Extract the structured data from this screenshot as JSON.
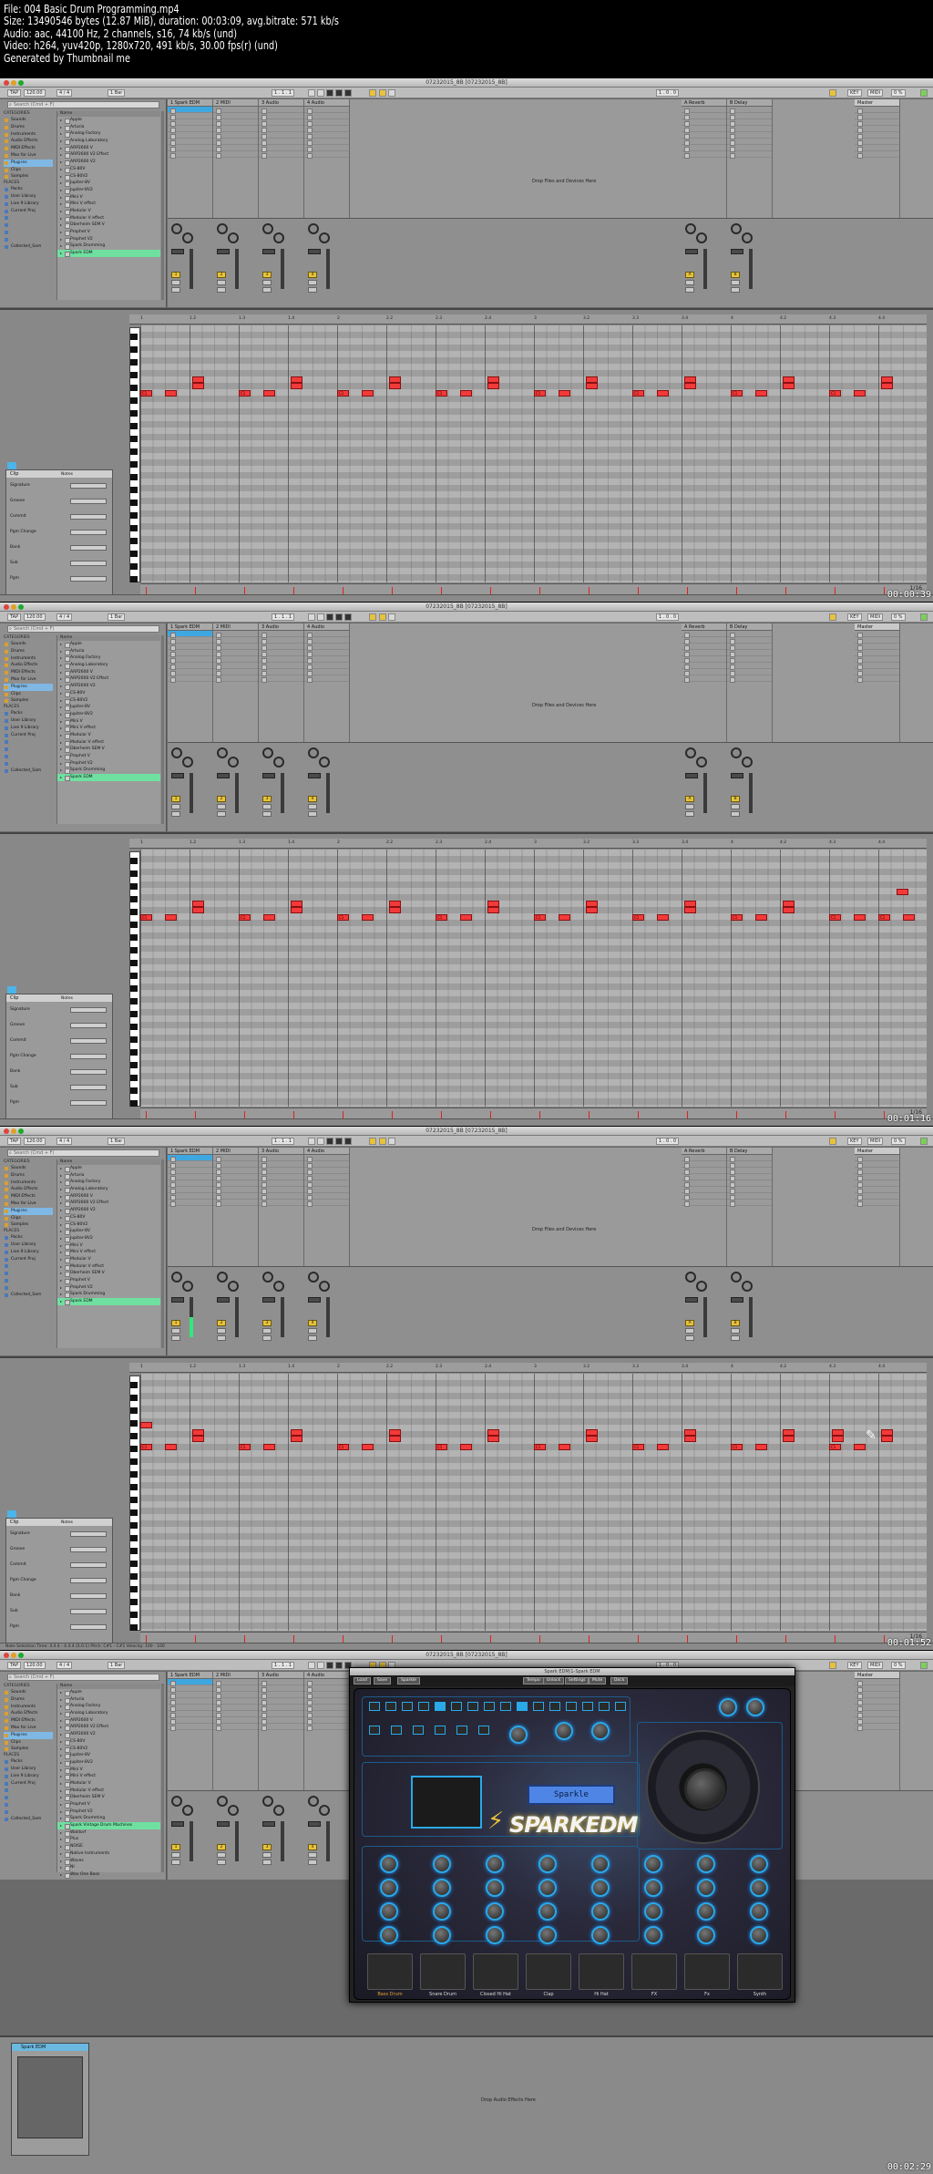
{
  "thumbnail_info": {
    "lines": [
      "File: 004 Basic Drum Programming.mp4",
      "Size: 13490546 bytes (12.87 MiB), duration: 00:03:09, avg.bitrate: 571 kb/s",
      "Audio: aac, 44100 Hz, 2 channels, s16, 74 kb/s (und)",
      "Video: h264, yuv420p, 1280x720, 491 kb/s, 30.00 fps(r) (und)",
      "Generated by Thumbnail me"
    ]
  },
  "window": {
    "title": "07232015_8B  [07232015_8B]"
  },
  "controlbar": {
    "tap": "TAP",
    "tempo": "120.00",
    "sig": "4 / 4",
    "quant": "1 Bar",
    "pos1": "1 . 1 . 1",
    "pos2": "1 . 0 . 0",
    "key": "KEY",
    "midi": "MIDI",
    "cpu": "0 %"
  },
  "browser": {
    "search_placeholder": "Search (Cmd + F)",
    "categories_header": "CATEGORIES",
    "categories": [
      "Sounds",
      "Drums",
      "Instruments",
      "Audio Effects",
      "MIDI Effects",
      "Max for Live",
      "Plug-ins",
      "Clips",
      "Samples"
    ],
    "places_header": "PLACES",
    "places": [
      "Packs",
      "User Library",
      "Live 9 Library",
      "Current Proj",
      "",
      "",
      "",
      "",
      "Collected_Sam"
    ],
    "name_header": "Name",
    "names": [
      "Apple",
      "Arturia",
      "Analog Factory",
      "Analog Laboratory",
      "ARP2600 V",
      "ARP2600 V2 Effect",
      "ARP2600 V2",
      "CS-80V",
      "CS-80V2",
      "Jupiter-8V",
      "Jupiter-8V2",
      "Mini V",
      "Mini V effect",
      "Modular V",
      "Modular V effect",
      "Oberheim SEM V",
      "Prophet V",
      "Prophet V2",
      "Spark Drumming",
      "Spark EDM"
    ]
  },
  "tracks": [
    {
      "name": "1 Spark EDM"
    },
    {
      "name": "2 MIDI"
    },
    {
      "name": "3 Audio"
    },
    {
      "name": "4 Audio"
    },
    {
      "name": "A Reverb"
    },
    {
      "name": "B Delay"
    },
    {
      "name": "Master"
    }
  ],
  "session": {
    "drop_text": "Drop Files and Devices Here"
  },
  "mixer": {
    "sends_label": "Sends",
    "strip_numbers": [
      "1",
      "2",
      "3",
      "4",
      "A",
      "B"
    ]
  },
  "clip": {
    "header": "Clip",
    "notes_header": "Notes",
    "fields": [
      "Signature",
      "Groove",
      "Commit",
      "Pgm Change",
      "Bank",
      "Sub",
      "Pgm"
    ],
    "quant_label": "1/16"
  },
  "ruler_ticks": [
    "1",
    "1.2",
    "1.3",
    "1.4",
    "2",
    "2.2",
    "2.3",
    "2.4",
    "3",
    "3.2",
    "3.3",
    "3.4",
    "4",
    "4.2",
    "4.3",
    "4.4"
  ],
  "note_label": "C1",
  "frames": [
    {
      "timestamp": "00:00:39",
      "status": ""
    },
    {
      "timestamp": "00:01:16",
      "status": ""
    },
    {
      "timestamp": "00:01:52",
      "status": "Note Selection    Time: 4.4.4 - 4.4.4 (0.0.1)    Pitch: C#1 - C#1    Velocity: 100 - 100"
    },
    {
      "timestamp": "00:02:29",
      "status": ""
    }
  ],
  "frame4": {
    "plugin_title": "Spark EDM/1-Spark EDM",
    "plugin_buttons": [
      "Load",
      "Save",
      "Sparkle",
      "Tempo",
      "Unlock",
      "Settings",
      "Mute",
      "Dock"
    ],
    "lcd_text": "Sparkle",
    "logo_text": "SPARKEDM",
    "pad_labels": [
      "Bass Drum",
      "Snare Drum",
      "Closed Hi Hat",
      "Clap",
      "Hi Hat",
      "FX",
      "Fx",
      "Synth"
    ],
    "browser_names_extra": [
      "Spark Vintage Drum Machines",
      "Waldorf",
      "Plus",
      "NOISE",
      "Native Instruments",
      "Waves",
      "NI",
      "Wav One Bass"
    ],
    "detail_device_name": "Spark EDM",
    "detail_drop_text": "Drop Audio Effects Here"
  },
  "colors": {
    "note": "#f23a3a",
    "clip": "#3fa7e0",
    "accent": "#e8c23a",
    "spark_blue": "#29a9e8"
  }
}
